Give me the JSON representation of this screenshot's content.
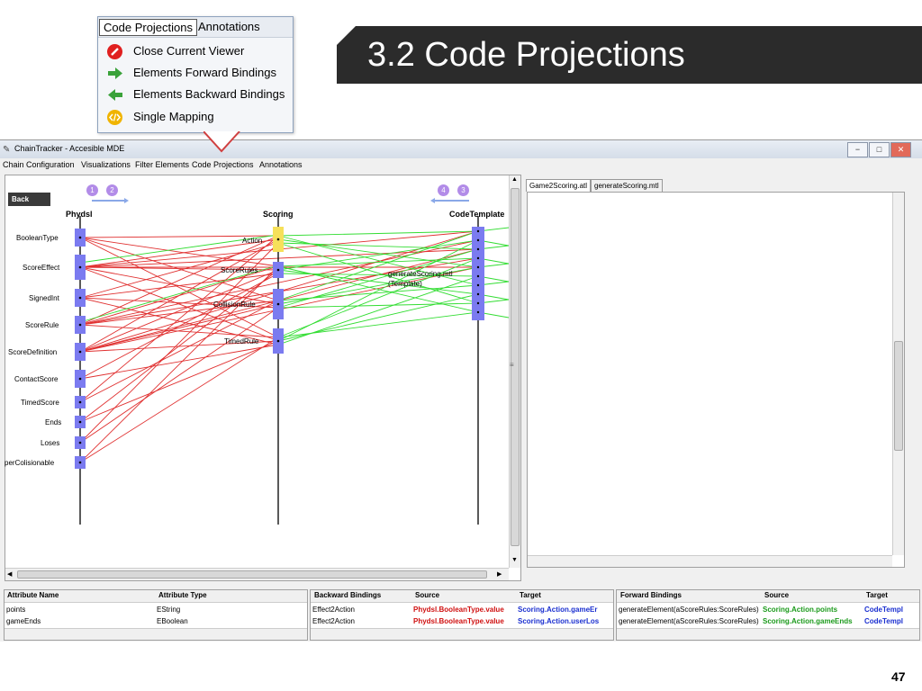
{
  "slide": {
    "title": "3.2 Code Projections",
    "page_number": "47"
  },
  "popup_menu": {
    "tabs": [
      "Code Projections",
      "Annotations"
    ],
    "items": [
      {
        "label": "Close Current Viewer",
        "icon": "close-viewer-icon",
        "color": "#e02020"
      },
      {
        "label": "Elements Forward Bindings",
        "icon": "forward-arrow-icon",
        "color": "#3aa23a"
      },
      {
        "label": "Elements Backward Bindings",
        "icon": "backward-arrow-icon",
        "color": "#3aa23a"
      },
      {
        "label": "Single Mapping",
        "icon": "code-tag-icon",
        "color": "#f0b400"
      }
    ]
  },
  "app": {
    "title": "ChainTracker - Accesible MDE",
    "window_buttons": [
      "−",
      "□",
      "✕"
    ],
    "menu": [
      "Chain Configuration",
      "Visualizations",
      "Filter Elements",
      "Code Projections",
      "Annotations"
    ]
  },
  "viz": {
    "back_label": "Back",
    "nav_left": [
      "1",
      "2"
    ],
    "nav_right": [
      "4",
      "3"
    ],
    "columns": {
      "phydsl": "Phydsl",
      "scoring": "Scoring",
      "codetemplate": "CodeTemplate"
    },
    "phydsl_nodes": [
      "BooleanType",
      "ScoreEffect",
      "SignedInt",
      "ScoreRule",
      "ScoreDefinition",
      "ContactScore",
      "TimedScore",
      "Ends",
      "Loses",
      "perColisionable"
    ],
    "scoring_nodes": [
      "Action",
      "ScoreRules",
      "CollisionRule",
      "TimedRule"
    ],
    "template_nodes": [
      "generateScoring.mtl",
      "(Template)"
    ],
    "colors": {
      "backward": "#e03030",
      "forward": "#33dd33",
      "node": "#7b7bf0",
      "highlight": "#f6e05a"
    }
  },
  "editor": {
    "tabs": [
      "Game2Scoring.atl",
      "generateScoring.mtl"
    ]
  },
  "tables": {
    "attributes": {
      "headers": [
        "Attribute Name",
        "Attribute Type"
      ],
      "rows": [
        [
          "points",
          "EString"
        ],
        [
          "gameEnds",
          "EBoolean"
        ]
      ]
    },
    "backward": {
      "headers": [
        "Backward Bindings",
        "Source",
        "Target"
      ],
      "rows": [
        [
          "Effect2Action",
          "Phydsl.BooleanType.value",
          "Scoring.Action.gameEr"
        ],
        [
          "Effect2Action",
          "Phydsl.BooleanType.value",
          "Scoring.Action.userLos"
        ]
      ]
    },
    "forward": {
      "headers": [
        "Forward Bindings",
        "Source",
        "Target"
      ],
      "rows": [
        [
          "generateElement(aScoreRules:ScoreRules)",
          "Scoring.Action.points",
          "CodeTempl"
        ],
        [
          "generateElement(aScoreRules:ScoreRules)",
          "Scoring.Action.gameEnds",
          "CodeTempl"
        ]
      ]
    }
  }
}
